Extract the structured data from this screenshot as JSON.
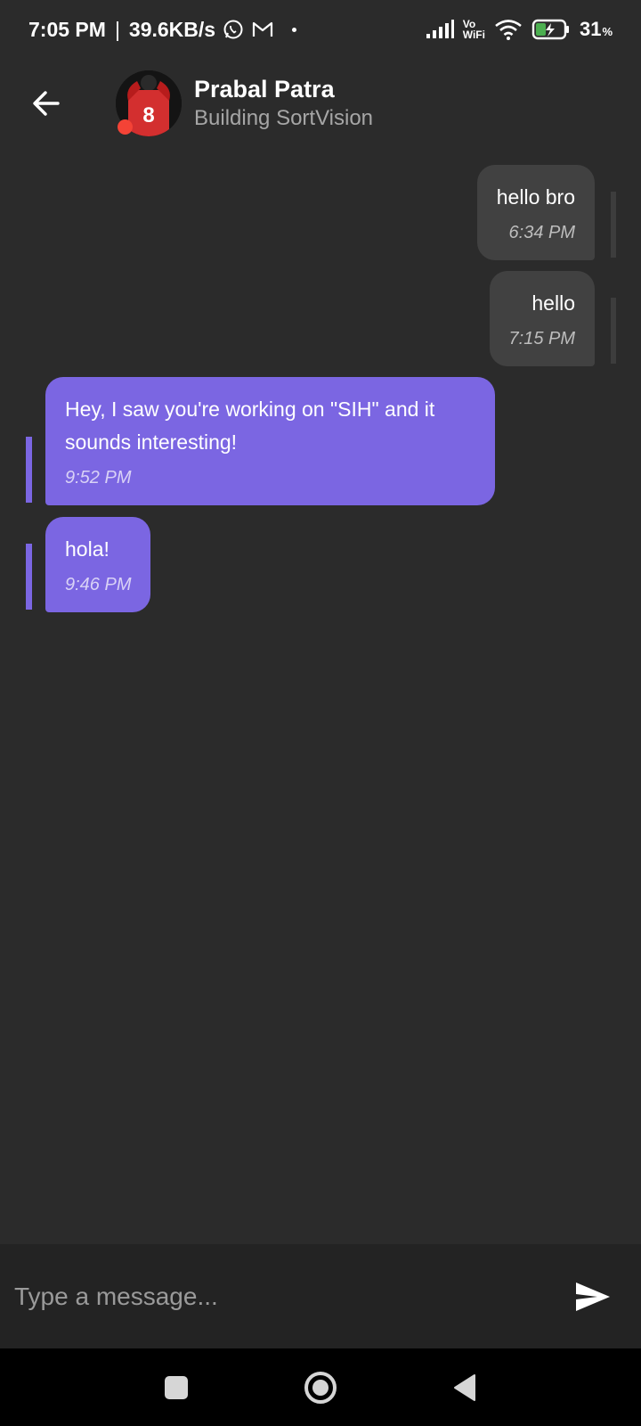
{
  "status_bar": {
    "time": "7:05 PM",
    "separator": "|",
    "network_speed": "39.6KB/s",
    "vo": "Vo",
    "wifi_label": "WiFi",
    "battery": "31",
    "battery_unit": "%",
    "icons": [
      "whatsapp-icon",
      "gmail-icon",
      "signal-icon",
      "wifi-icon",
      "battery-charging-icon"
    ]
  },
  "header": {
    "name": "Prabal Patra",
    "status": "Building SortVision",
    "online_dot_color": "#f44336"
  },
  "messages": [
    {
      "direction": "sent",
      "text": "hello bro",
      "time": "6:34 PM"
    },
    {
      "direction": "sent",
      "text": "hello",
      "time": "7:15 PM"
    },
    {
      "direction": "received",
      "text": "Hey, I saw you're working on \"SIH\" and it sounds interesting!",
      "time": "9:52 PM"
    },
    {
      "direction": "received",
      "text": "hola!",
      "time": "9:46 PM"
    }
  ],
  "composer": {
    "placeholder": "Type a message...",
    "value": ""
  },
  "colors": {
    "background": "#2b2b2b",
    "sent_bubble": "#414141",
    "received_bubble": "#7b66e2",
    "input_bar": "#232323"
  }
}
